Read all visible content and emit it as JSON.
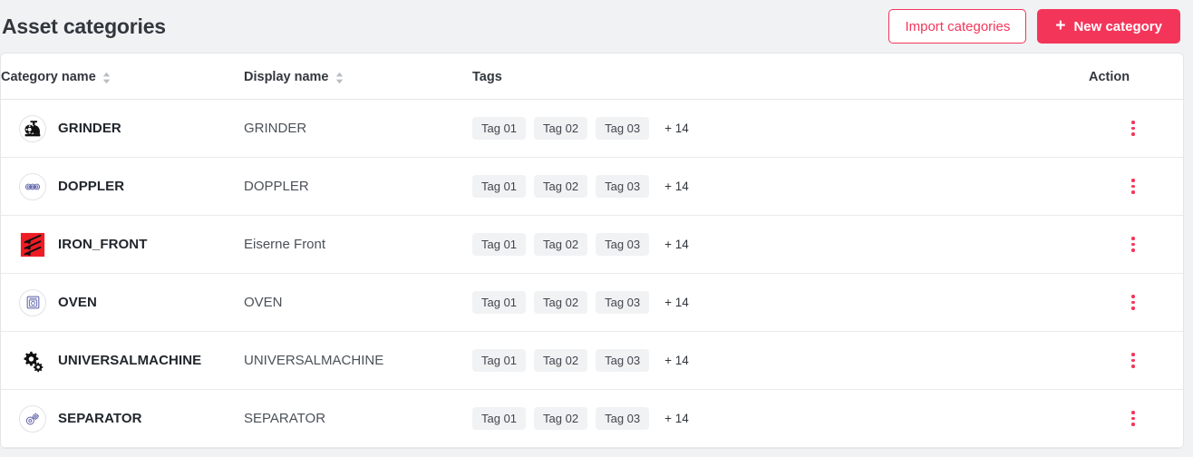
{
  "header": {
    "title": "Asset categories",
    "import_button": "Import categories",
    "new_button": "New category",
    "plus_glyph": "+"
  },
  "table": {
    "columns": {
      "category_name": "Category name",
      "display_name": "Display name",
      "tags": "Tags",
      "action": "Action"
    },
    "rows": [
      {
        "icon": "grinder-icon",
        "category_name": "GRINDER",
        "display_name": "GRINDER",
        "tags": [
          "Tag 01",
          "Tag 02",
          "Tag 03"
        ],
        "tags_more": "+ 14"
      },
      {
        "icon": "doppler-icon",
        "category_name": "DOPPLER",
        "display_name": "DOPPLER",
        "tags": [
          "Tag 01",
          "Tag 02",
          "Tag 03"
        ],
        "tags_more": "+ 14"
      },
      {
        "icon": "iron-front-icon",
        "category_name": "IRON_FRONT",
        "display_name": "Eiserne Front",
        "tags": [
          "Tag 01",
          "Tag 02",
          "Tag 03"
        ],
        "tags_more": "+ 14"
      },
      {
        "icon": "oven-icon",
        "category_name": "OVEN",
        "display_name": "OVEN",
        "tags": [
          "Tag 01",
          "Tag 02",
          "Tag 03"
        ],
        "tags_more": "+ 14"
      },
      {
        "icon": "gears-icon",
        "category_name": "UNIVERSALMACHINE",
        "display_name": "UNIVERSALMACHINE",
        "tags": [
          "Tag 01",
          "Tag 02",
          "Tag 03"
        ],
        "tags_more": "+ 14"
      },
      {
        "icon": "separator-icon",
        "category_name": "SEPARATOR",
        "display_name": "SEPARATOR",
        "tags": [
          "Tag 01",
          "Tag 02",
          "Tag 03"
        ],
        "tags_more": "+ 14"
      }
    ]
  },
  "colors": {
    "accent": "#f4355a",
    "page_background": "#f1f2f4",
    "card_background": "#ffffff",
    "border": "#e3e5e8",
    "icon_blue": "#5b5ea6",
    "icon_black": "#111111",
    "icon_red": "#ee1c25",
    "text_primary": "#21262c",
    "text_secondary": "#4b5158"
  }
}
